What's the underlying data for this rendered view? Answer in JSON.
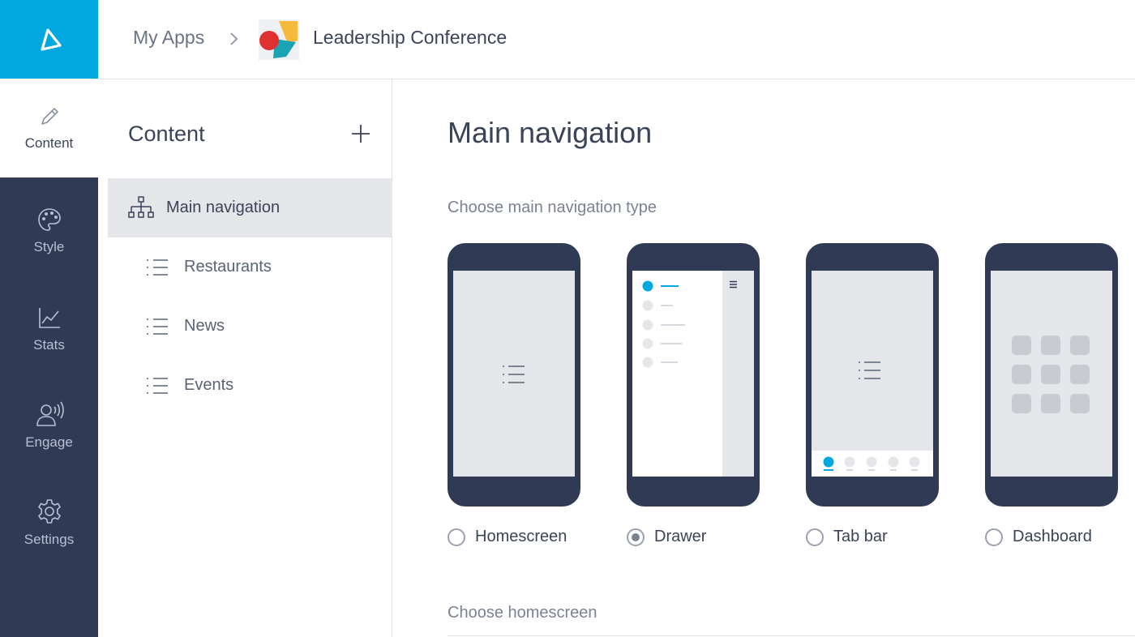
{
  "rail": {
    "items": [
      {
        "label": "Content",
        "icon": "pencil-icon"
      },
      {
        "label": "Style",
        "icon": "palette-icon"
      },
      {
        "label": "Stats",
        "icon": "chart-icon"
      },
      {
        "label": "Engage",
        "icon": "engage-icon"
      },
      {
        "label": "Settings",
        "icon": "gear-icon"
      }
    ],
    "active": "Content"
  },
  "breadcrumb": {
    "root": "My Apps",
    "current": "Leadership Conference"
  },
  "content_panel": {
    "title": "Content",
    "items": [
      {
        "label": "Main navigation",
        "icon": "sitemap-icon",
        "active": true
      },
      {
        "label": "Restaurants",
        "icon": "list-icon"
      },
      {
        "label": "News",
        "icon": "list-icon"
      },
      {
        "label": "Events",
        "icon": "list-icon"
      }
    ]
  },
  "main": {
    "title": "Main navigation",
    "nav_type_label": "Choose main navigation type",
    "homescreen_label": "Choose homescreen",
    "options": [
      {
        "label": "Homescreen",
        "selected": false
      },
      {
        "label": "Drawer",
        "selected": true
      },
      {
        "label": "Tab bar",
        "selected": false
      },
      {
        "label": "Dashboard",
        "selected": false
      }
    ]
  },
  "colors": {
    "accent": "#00a8e0",
    "rail_bg": "#303a55",
    "active_item_bg": "#e4e6ea"
  }
}
